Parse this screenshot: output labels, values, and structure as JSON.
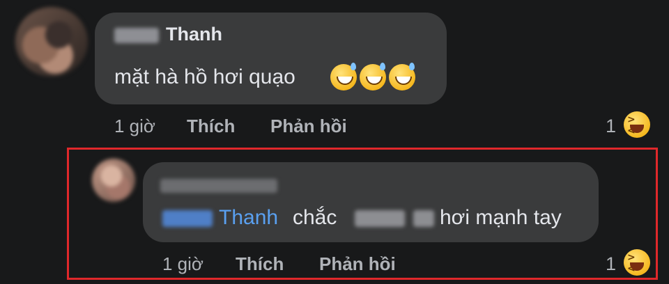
{
  "comment_1": {
    "author": "Thanh",
    "text": "mặt hà hồ hơi quạo",
    "emojis": [
      "grinning-sweat-emoji",
      "grinning-sweat-emoji",
      "grinning-sweat-emoji"
    ],
    "time": "1 giờ",
    "like_label": "Thích",
    "reply_label": "Phản hồi",
    "reaction_count": "1",
    "reaction_icon": "laughing-emoji"
  },
  "comment_2": {
    "mention": "Thanh",
    "text_before": "chắc",
    "text_after": "hơi mạnh tay",
    "time": "1 giờ",
    "like_label": "Thích",
    "reply_label": "Phản hồi",
    "reaction_count": "1",
    "reaction_icon": "laughing-emoji"
  },
  "colors": {
    "background": "#18191a",
    "bubble": "#3a3b3c",
    "mention": "#5aa0f0",
    "highlight_border": "#e0282b"
  }
}
